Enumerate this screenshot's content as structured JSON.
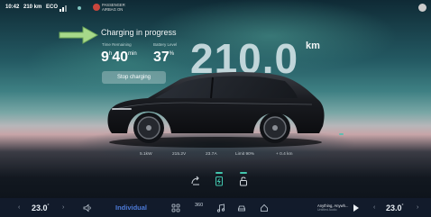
{
  "status_bar": {
    "time": "10:42",
    "range": "210 km",
    "mode_icon": "eco-icon",
    "airbag_text": "PASSENGER AIRBAG ON"
  },
  "charging": {
    "title": "Charging in progress",
    "time_remaining_label": "Time Remaining",
    "time_hours": "9",
    "time_hours_unit": "h",
    "time_minutes": "40",
    "time_minutes_unit": "min",
    "battery_label": "Battery Level",
    "battery_value": "37",
    "battery_unit": "%",
    "stop_button": "Stop charging",
    "range_value": "210.0",
    "range_unit": "km"
  },
  "stats": {
    "power": "5.1kW",
    "voltage": "215.2V",
    "current": "23.7A",
    "limit": "Limit 90%",
    "gain": "+ 0.4 km"
  },
  "dock": {
    "left_temp": "23.0",
    "left_temp_unit": "°",
    "mode_label": "Individual",
    "camera_label": "360",
    "music_title": "Anything, Anywh...",
    "music_artist": "Untitled Audio",
    "right_temp": "23.0",
    "right_temp_unit": "°"
  },
  "colors": {
    "accent_teal": "#42c7ae",
    "mode_blue": "#4d7bd8",
    "arrow_green": "#a7d88a",
    "airbag_red": "#c9463d"
  }
}
